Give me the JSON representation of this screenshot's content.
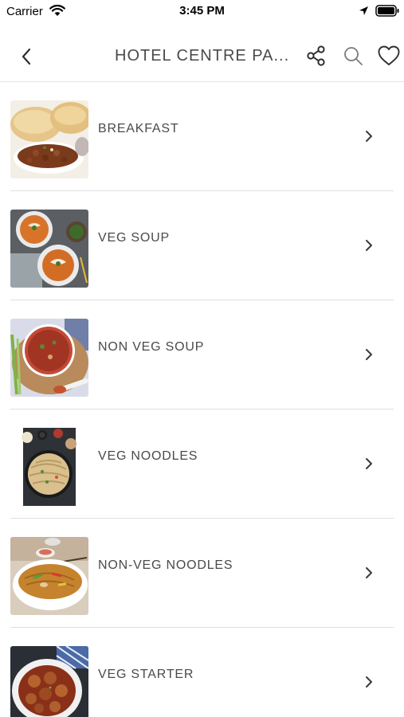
{
  "status_bar": {
    "carrier": "Carrier",
    "time": "3:45 PM"
  },
  "nav": {
    "title": "HOTEL CENTRE PA..."
  },
  "icons": {
    "back": "chevron-left-icon",
    "share": "share-icon",
    "search": "search-icon",
    "favorite": "heart-icon",
    "row_arrow": "chevron-right-icon"
  },
  "categories": [
    {
      "label": "BREAKFAST",
      "image": "puri-chole-plate"
    },
    {
      "label": "VEG SOUP",
      "image": "creamy-soup-bowls"
    },
    {
      "label": "NON VEG SOUP",
      "image": "spicy-soup-bowl"
    },
    {
      "label": "VEG NOODLES",
      "image": "noodles-pan"
    },
    {
      "label": "NON-VEG NOODLES",
      "image": "chicken-noodles-bowl"
    },
    {
      "label": "VEG STARTER",
      "image": "manchurian-bowl"
    }
  ],
  "colors": {
    "text": "#4a4a4a",
    "divider": "#e0e0e0",
    "background": "#ffffff"
  }
}
